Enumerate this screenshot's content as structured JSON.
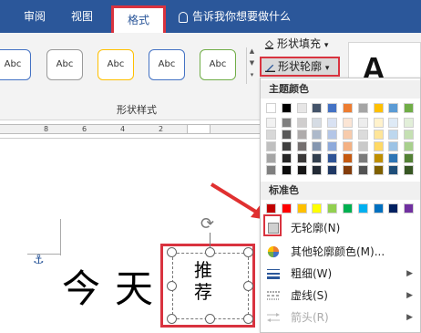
{
  "tabs": [
    {
      "label": "审阅"
    },
    {
      "label": "视图"
    },
    {
      "label": "格式",
      "active": true
    }
  ],
  "tellme": {
    "label": "告诉我你想要做什么"
  },
  "gallery": {
    "items": [
      {
        "label": "Abc",
        "border": "#4472c4"
      },
      {
        "label": "Abc",
        "border": "#9a9a9a"
      },
      {
        "label": "Abc",
        "border": "#ffc000"
      },
      {
        "label": "Abc",
        "border": "#4472c4"
      },
      {
        "label": "Abc",
        "border": "#70ad47"
      }
    ]
  },
  "group": {
    "label": "形状样式"
  },
  "fill": {
    "label": "形状填充",
    "arrow": "▾"
  },
  "outline": {
    "label": "形状轮廓",
    "arrow": "▾"
  },
  "wordart": {
    "glyph": "A"
  },
  "ruler": {
    "marks": [
      "8",
      "6",
      "4",
      "2"
    ]
  },
  "document": {
    "chars": [
      "今",
      "天"
    ],
    "shape_text": [
      "推",
      "荐"
    ]
  },
  "menu": {
    "theme_header": "主题颜色",
    "standard_header": "标准色",
    "theme_colors": [
      [
        "#ffffff",
        "#000000",
        "#e7e6e6",
        "#44546a",
        "#4472c4",
        "#ed7d31",
        "#a5a5a5",
        "#ffc000",
        "#5b9bd5",
        "#70ad47"
      ],
      [
        "#f2f2f2",
        "#7f7f7f",
        "#d0cece",
        "#d6dce4",
        "#d9e2f3",
        "#fbe5d5",
        "#ededed",
        "#fff2cc",
        "#deeaf6",
        "#e2efd9"
      ],
      [
        "#d8d8d8",
        "#595959",
        "#aeabab",
        "#adb9ca",
        "#b4c6e7",
        "#f7cbac",
        "#dbdbdb",
        "#fee599",
        "#bdd7ee",
        "#c5e0b3"
      ],
      [
        "#bfbfbf",
        "#3f3f3f",
        "#757070",
        "#8496b0",
        "#8eaadb",
        "#f4b183",
        "#c9c9c9",
        "#ffd965",
        "#9cc3e5",
        "#a8d08d"
      ],
      [
        "#a5a5a5",
        "#262626",
        "#3a3838",
        "#323f4f",
        "#2f5496",
        "#c55a11",
        "#7b7b7b",
        "#bf8f00",
        "#2e75b5",
        "#538135"
      ],
      [
        "#7f7f7f",
        "#0c0c0c",
        "#171616",
        "#222a35",
        "#1f3864",
        "#833c0b",
        "#525252",
        "#7f6000",
        "#1e4e79",
        "#375623"
      ]
    ],
    "standard_colors": [
      "#c00000",
      "#ff0000",
      "#ffc000",
      "#ffff00",
      "#92d050",
      "#00b050",
      "#00b0f0",
      "#0070c0",
      "#002060",
      "#7030a0"
    ],
    "items": [
      {
        "label": "无轮廓(N)",
        "icon": "no-outline-icon"
      },
      {
        "label": "其他轮廓颜色(M)...",
        "icon": "color-wheel-icon"
      },
      {
        "label": "粗细(W)",
        "icon": "weight-icon",
        "submenu": true
      },
      {
        "label": "虚线(S)",
        "icon": "dash-icon",
        "submenu": true
      },
      {
        "label": "箭头(R)",
        "icon": "arrow-style-icon",
        "submenu": true,
        "disabled": true
      }
    ]
  },
  "colors": {
    "brand": "#2b579a",
    "highlight": "#d9333f"
  }
}
